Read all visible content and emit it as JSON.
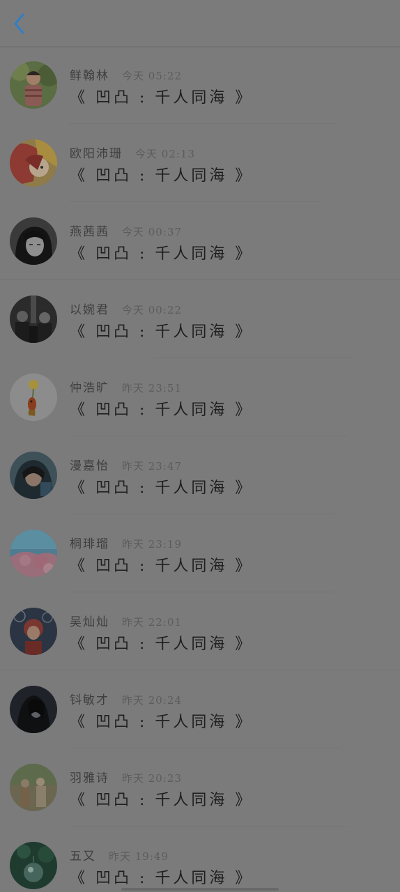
{
  "header": {
    "back_icon": "chevron-left-icon",
    "accent_color": "#2f7fc8"
  },
  "items": [
    {
      "name": "鲜翰林",
      "time": "今天 05:22",
      "title": "《 凹凸 : 千人同海 》",
      "avatar": "boy-in-plaid"
    },
    {
      "name": "欧阳沛珊",
      "time": "今天 02:13",
      "title": "《 凹凸 : 千人同海 》",
      "avatar": "anime-red-hair"
    },
    {
      "name": "燕茜茜",
      "time": "今天 00:37",
      "title": "《 凹凸 : 千人同海 》",
      "avatar": "girl-bw-portrait"
    },
    {
      "name": "以婉君",
      "time": "今天 00:22",
      "title": "《 凹凸 : 千人同海 》",
      "avatar": "dark-group-photo"
    },
    {
      "name": "仲浩旷",
      "time": "昨天 23:51",
      "title": "《 凹凸 : 千人同海 》",
      "avatar": "goldfish-flower"
    },
    {
      "name": "漫嘉怡",
      "time": "昨天 23:47",
      "title": "《 凹凸 : 千人同海 》",
      "avatar": "girl-hood-portrait"
    },
    {
      "name": "桐琲瑠",
      "time": "昨天 23:19",
      "title": "《 凹凸 : 千人同海 》",
      "avatar": "pink-blossom-sky"
    },
    {
      "name": "吴灿灿",
      "time": "昨天 22:01",
      "title": "《 凹凸 : 千人同海 》",
      "avatar": "red-hair-fireworks"
    },
    {
      "name": "钭敏才",
      "time": "昨天 20:24",
      "title": "《 凹凸 : 千人同海 》",
      "avatar": "dark-figure"
    },
    {
      "name": "羽雅诗",
      "time": "昨天 20:23",
      "title": "《 凹凸 : 千人同海 》",
      "avatar": "vintage-painting"
    },
    {
      "name": "五又",
      "time": "昨天 19:49",
      "title": "《 凹凸 : 千人同海 》",
      "avatar": "glass-sphere-green"
    }
  ]
}
